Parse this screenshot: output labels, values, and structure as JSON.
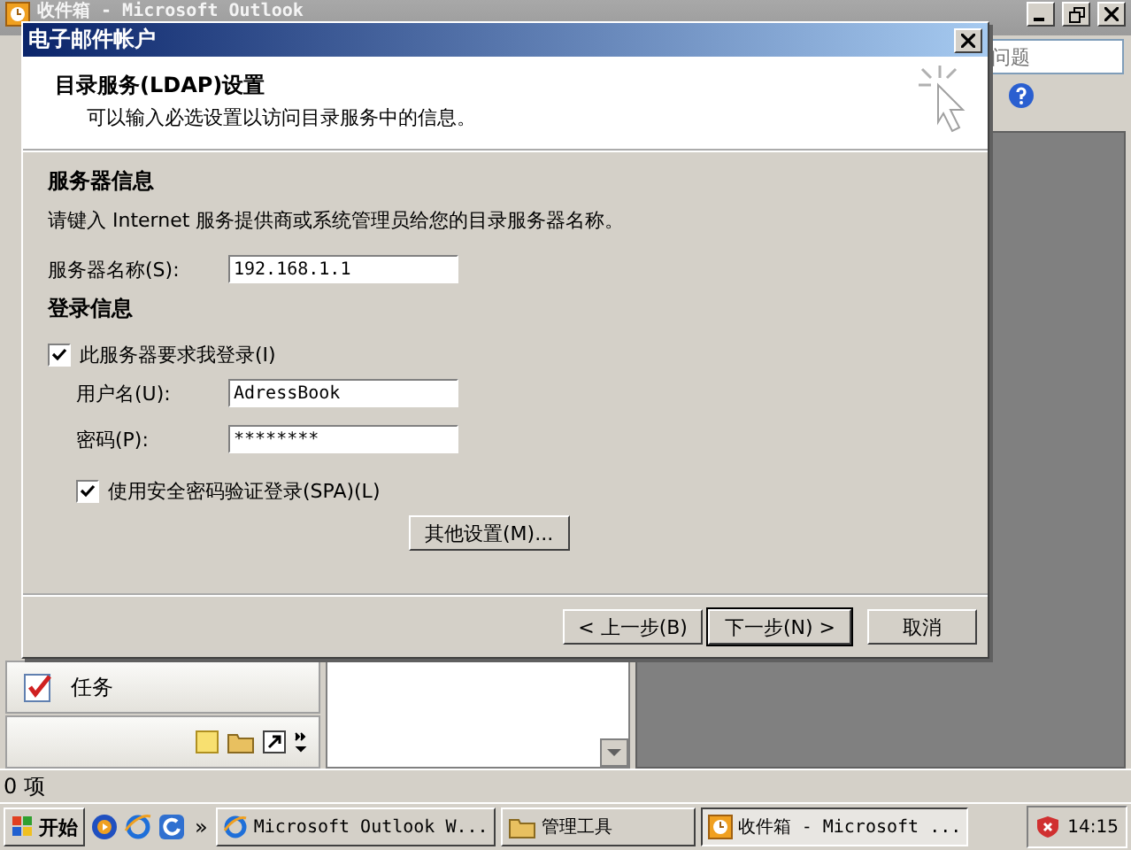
{
  "outlook": {
    "title": "收件箱 - Microsoft Outlook",
    "help_field": {
      "placeholder": "问题"
    },
    "nav_items": [
      {
        "label": "任务"
      }
    ],
    "status_bar": "0 项"
  },
  "dialog": {
    "title": "电子邮件帐户",
    "header": {
      "title": "目录服务(LDAP)设置",
      "subtitle": "可以输入必选设置以访问目录服务中的信息。"
    },
    "server_section": {
      "heading": "服务器信息",
      "description": "请键入 Internet 服务提供商或系统管理员给您的目录服务器名称。",
      "server_label": "服务器名称(S):",
      "server_value": "192.168.1.1"
    },
    "login_section": {
      "heading": "登录信息",
      "require_login": {
        "label": "此服务器要求我登录(I)",
        "checked": true
      },
      "username_label": "用户名(U):",
      "username_value": "AdressBook",
      "password_label": "密码(P):",
      "password_value": "********",
      "spa": {
        "label": "使用安全密码验证登录(SPA)(L)",
        "checked": true
      },
      "more_settings": "其他设置(M)..."
    },
    "buttons": [
      {
        "label": "< 上一步(B)",
        "default": false
      },
      {
        "label": "下一步(N) >",
        "default": true
      },
      {
        "label": "取消",
        "default": false
      }
    ]
  },
  "taskbar": {
    "start": "开始",
    "overflow": "»",
    "tasks": [
      {
        "label": "Microsoft Outlook W...",
        "kind": "browser",
        "selected": false
      },
      {
        "label": "管理工具",
        "kind": "folder",
        "selected": false
      },
      {
        "label": "收件箱 - Microsoft ...",
        "kind": "outlook",
        "selected": true
      }
    ],
    "clock": "14:15"
  }
}
